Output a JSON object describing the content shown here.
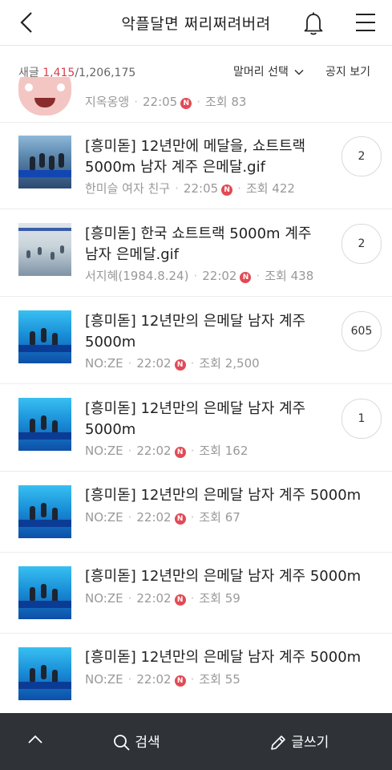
{
  "header": {
    "title": "악플달면 쩌리쩌려버려"
  },
  "info": {
    "prefix": "새글 ",
    "new_count": "1,415",
    "total": "/1,206,175",
    "filter_label": "말머리 선택",
    "notice_label": "공지 보기"
  },
  "posts": [
    {
      "title_line1": "",
      "title_line2": "",
      "author": "지옥옹앵",
      "time": "22:05",
      "views": "조회 83",
      "comments": ""
    },
    {
      "title_line1": "[흥미돋] 12년만에 메달을, 쇼트트랙",
      "title_line2": "5000m 남자 계주 은메달.gif",
      "author": "한미슬 여자 친구",
      "time": "22:05",
      "views": "조회 422",
      "comments": "2"
    },
    {
      "title_line1": "[흥미돋] 한국 쇼트트랙 5000m 계주",
      "title_line2": "남자 은메달.gif",
      "author": "서지혜(1984.8.24)",
      "time": "22:02",
      "views": "조회 438",
      "comments": "2"
    },
    {
      "title_line1": "[흥미돋] 12년만의 은메달 남자 계주",
      "title_line2": "5000m",
      "author": "NO:ZE",
      "time": "22:02",
      "views": "조회 2,500",
      "comments": "605"
    },
    {
      "title_line1": "[흥미돋] 12년만의 은메달 남자 계주",
      "title_line2": "5000m",
      "author": "NO:ZE",
      "time": "22:02",
      "views": "조회 162",
      "comments": "1"
    },
    {
      "title_line1": "[흥미돋] 12년만의 은메달 남자 계주 5000m",
      "title_line2": "",
      "author": "NO:ZE",
      "time": "22:02",
      "views": "조회 67",
      "comments": ""
    },
    {
      "title_line1": "[흥미돋] 12년만의 은메달 남자 계주 5000m",
      "title_line2": "",
      "author": "NO:ZE",
      "time": "22:02",
      "views": "조회 59",
      "comments": ""
    },
    {
      "title_line1": "[흥미돋] 12년만의 은메달 남자 계주 5000m",
      "title_line2": "",
      "author": "NO:ZE",
      "time": "22:02",
      "views": "조회 55",
      "comments": ""
    }
  ],
  "new_badge": "N",
  "bottom_bar": {
    "search_label": "검색",
    "write_label": "글쓰기"
  }
}
